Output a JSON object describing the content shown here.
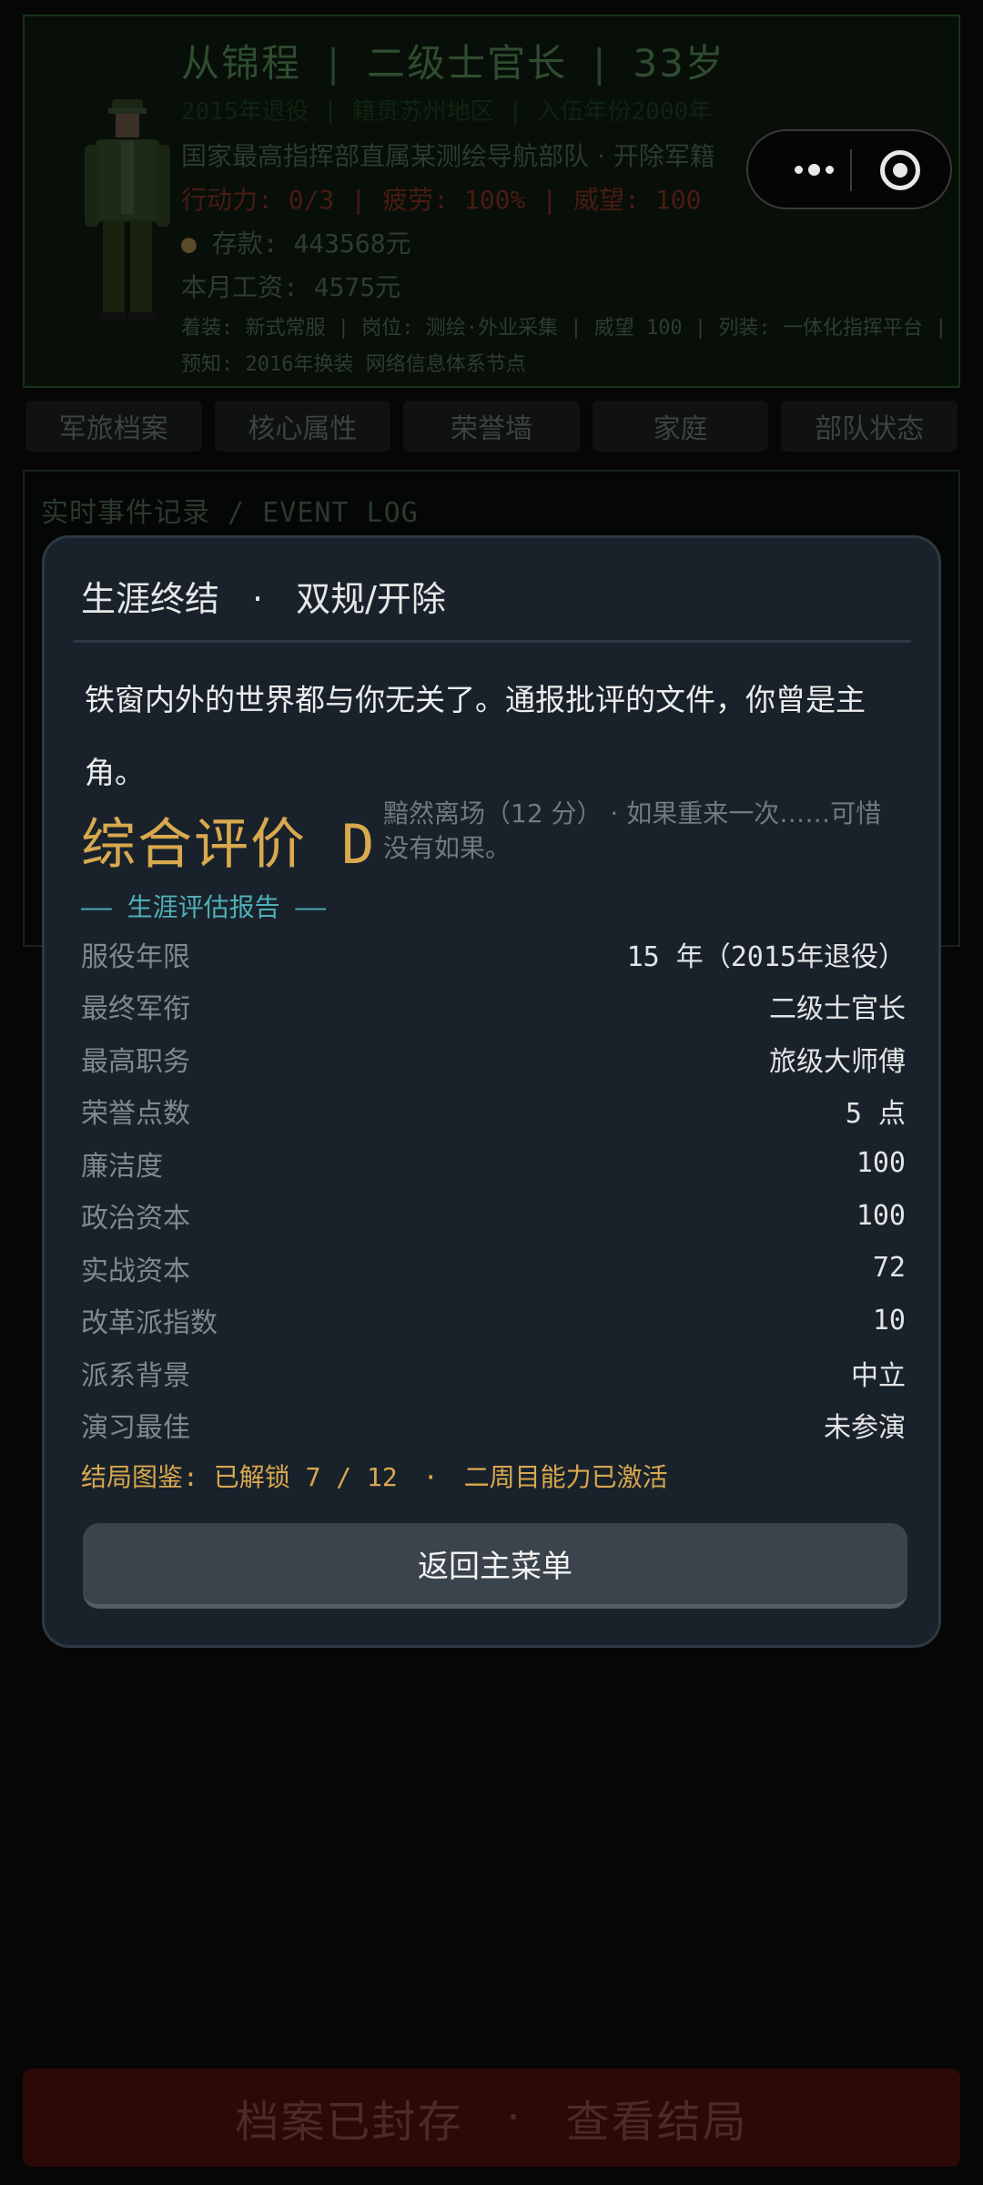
{
  "profile": {
    "name": "从锦程",
    "rank": "二级士官长",
    "age": "33岁",
    "faint_line": "2015年退役  |  籍贯苏州地区  |  入伍年份2000年",
    "unit": "国家最高指挥部直属某测绘导航部队",
    "unit_status": "开除军籍",
    "action_points": "行动力: 0/3",
    "fatigue": "疲劳: 100%",
    "prestige": "威望: 100",
    "money_icon": "money-bag-icon",
    "savings": "存款: 443568元",
    "salary": "本月工资: 4575元",
    "info_line1": "着装: 新式常服 | 岗位: 测绘·外业采集 | 威望 100 | 列装: 一体化指挥平台 |",
    "info_line2": "预知: 2016年换装  网络信息体系节点"
  },
  "tabs": [
    "军旅档案",
    "核心属性",
    "荣誉墙",
    "家庭",
    "部队状态"
  ],
  "log": {
    "title": "实时事件记录 / EVENT LOG"
  },
  "modal": {
    "title": "生涯终结",
    "reason": "双规/开除",
    "narrative": "铁窗内外的世界都与你无关了。通报批评的文件，你曾是主角。",
    "grade_label": "综合评价",
    "grade": "D",
    "grade_desc": "黯然离场（12 分） · 如果重来一次……可惜没有如果。",
    "report_header": "—— 生涯评估报告 ——",
    "stats": [
      {
        "label": "服役年限",
        "value": "15 年（2015年退役）"
      },
      {
        "label": "最终军衔",
        "value": "二级士官长"
      },
      {
        "label": "最高职务",
        "value": "旅级大师傅"
      },
      {
        "label": "荣誉点数",
        "value": "5 点"
      },
      {
        "label": "廉洁度",
        "value": "100"
      },
      {
        "label": "政治资本",
        "value": "100"
      },
      {
        "label": "实战资本",
        "value": "72"
      },
      {
        "label": "改革派指数",
        "value": "10"
      },
      {
        "label": "派系背景",
        "value": "中立"
      },
      {
        "label": "演习最佳",
        "value": "未参演"
      }
    ],
    "codex": "结局图鉴: 已解锁 7 / 12",
    "newgame_plus": "二周目能力已激活",
    "return_label": "返回主菜单"
  },
  "bottom_bar": {
    "left": "档案已封存",
    "right": "查看结局"
  },
  "colors": {
    "accent_gold": "#d8a94e",
    "report_teal": "#4fb0b8",
    "modal_bg": "#19222b"
  }
}
